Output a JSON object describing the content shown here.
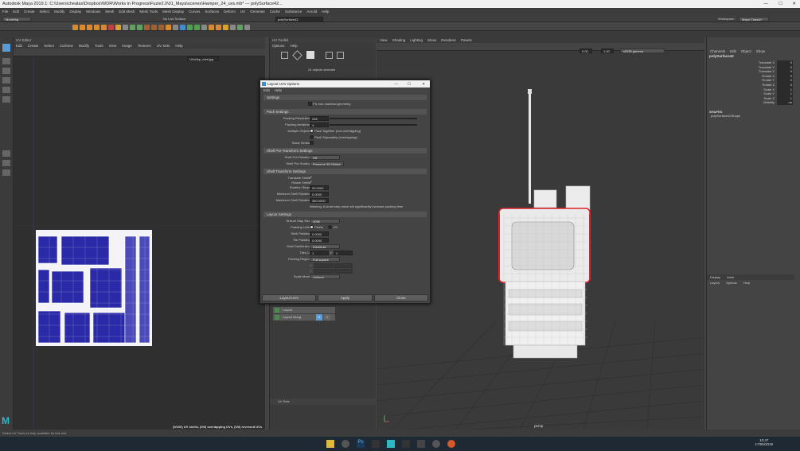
{
  "window": {
    "title": "Autodesk Maya 2019.1: C:\\Users\\chealas\\Dropbox\\WDR\\Works in Progress\\Fuzie2.0\\01_Maya\\scenes\\Hamper_24_uvs.mb* --- polySurface42..."
  },
  "menus": [
    "File",
    "Edit",
    "Create",
    "Select",
    "Modify",
    "Display",
    "Windows",
    "Mesh",
    "Edit Mesh",
    "Mesh Tools",
    "Mesh Display",
    "Curves",
    "Surfaces",
    "Deform",
    "UV",
    "Generate",
    "Cache",
    "Substance",
    "Arnold",
    "Help"
  ],
  "status": {
    "mode": "Modeling",
    "live": "No Live Surface",
    "object": "polySurface42",
    "workspace_label": "Workspace :",
    "workspace": "Maya Classic*"
  },
  "uv_editor": {
    "title": "UV Editor",
    "menus": [
      "Edit",
      "Create",
      "Select",
      "Cut/Sew",
      "Modify",
      "Tools",
      "View",
      "Image",
      "Textures",
      "UV Sets",
      "Help"
    ],
    "texture": "UVchkp_mint.jpg",
    "status": "(0/100) UV shells, (0/0) overlapping UVs, (0/0) reversed UVs"
  },
  "uv_toolkit": {
    "title": "UV Toolkit",
    "menus": [
      "Options",
      "Help"
    ],
    "info": "24 objects selected",
    "sections": [
      {
        "label": "Layout"
      },
      {
        "label": "Layout Along",
        "u": "U",
        "v": "V"
      }
    ],
    "footer": "UV Sets"
  },
  "viewport": {
    "menus": [
      "View",
      "Shading",
      "Lighting",
      "Show",
      "Renderer",
      "Panels"
    ],
    "camera": "persp",
    "near": "0.00",
    "far": "1.00",
    "colorspace": "sRGB gamma"
  },
  "dialog": {
    "title": "Layout UVs Options",
    "menus": [
      "Edit",
      "Help"
    ],
    "settings_title": "Settings",
    "fix_nonmanifold": "Fix non-manifold geometry",
    "pack_title": "Pack Settings",
    "packing_resolution": {
      "label": "Packing Resolution",
      "value": "256"
    },
    "packing_iterations": {
      "label": "Packing Iterations",
      "value": "4"
    },
    "multiple_objects": {
      "label": "Multiple Objects",
      "opt1": "Pack Together (non-overlapping)",
      "opt2": "Pack Separately (overlapping)"
    },
    "stack_similar": "Stack Similar",
    "shell_pre_title": "Shell Pre-Transform Settings",
    "shell_pre_rotation": {
      "label": "Shell Pre-Rotation",
      "value": "Off"
    },
    "shell_pre_scaling": {
      "label": "Shell Pre-Scaling",
      "value": "Preserve 3D Ratios"
    },
    "shell_transform_title": "Shell Transform Settings",
    "translate_shells": "Translate Shells",
    "rotate_shells": "Rotate Shells",
    "rotation_steps": {
      "label": "Rotation Steps",
      "value": "90.0000"
    },
    "min_rotation": {
      "label": "Minimum Shell Rotation",
      "value": "0.0000"
    },
    "max_rotation": {
      "label": "Maximum Shell Rotation",
      "value": "360.0000"
    },
    "warning": "Warning: A small step value will significantly increase packing time",
    "layout_title": "Layout Settings",
    "texture_map_size": {
      "label": "Texture Map Size",
      "value": "4096"
    },
    "padding_units": {
      "label": "Padding Units",
      "opt1": "Pixels",
      "opt2": "UV"
    },
    "shell_padding": {
      "label": "Shell Padding",
      "value": "0.0000"
    },
    "tile_padding": {
      "label": "Tile Padding",
      "value": "0.0000"
    },
    "shell_distribution": {
      "label": "Shell Distribution",
      "value": "Distribute"
    },
    "tiles": {
      "label": "Tiles U:",
      "u": "1",
      "v_label": "V:",
      "v": "1"
    },
    "packing_region": {
      "label": "Packing Region",
      "value": "Full square"
    },
    "region_u": "U:",
    "region_v": "V:",
    "scale_mode": {
      "label": "Scale Mode",
      "value": "Uniform"
    },
    "buttons": [
      "Layout UVs",
      "Apply",
      "Close"
    ]
  },
  "channel_box": {
    "tabs": [
      "Channels",
      "Edit",
      "Object",
      "Show"
    ],
    "object": "polySurface42",
    "rows": [
      {
        "name": "Translate X",
        "value": "0"
      },
      {
        "name": "Translate Y",
        "value": "0"
      },
      {
        "name": "Translate Z",
        "value": "0"
      },
      {
        "name": "Rotate X",
        "value": "0"
      },
      {
        "name": "Rotate Y",
        "value": "0"
      },
      {
        "name": "Rotate Z",
        "value": "0"
      },
      {
        "name": "Scale X",
        "value": "1"
      },
      {
        "name": "Scale Y",
        "value": "1"
      },
      {
        "name": "Scale Z",
        "value": "1"
      },
      {
        "name": "Visibility",
        "value": "on"
      }
    ],
    "shapes_title": "SHAPES",
    "shape": "polySurface42Shape",
    "layer_tabs": [
      "Display",
      "Anim"
    ],
    "layer_menus": [
      "Layers",
      "Options",
      "Help"
    ]
  },
  "help_line": "Select UV Tools for help available for this tool.",
  "taskbar": {
    "time": "10:47",
    "date": "17/06/2019"
  },
  "colors": {
    "accent": "#5b9bd5",
    "uv_blue": "#2a2aa8",
    "selection_red": "#e0202a"
  }
}
